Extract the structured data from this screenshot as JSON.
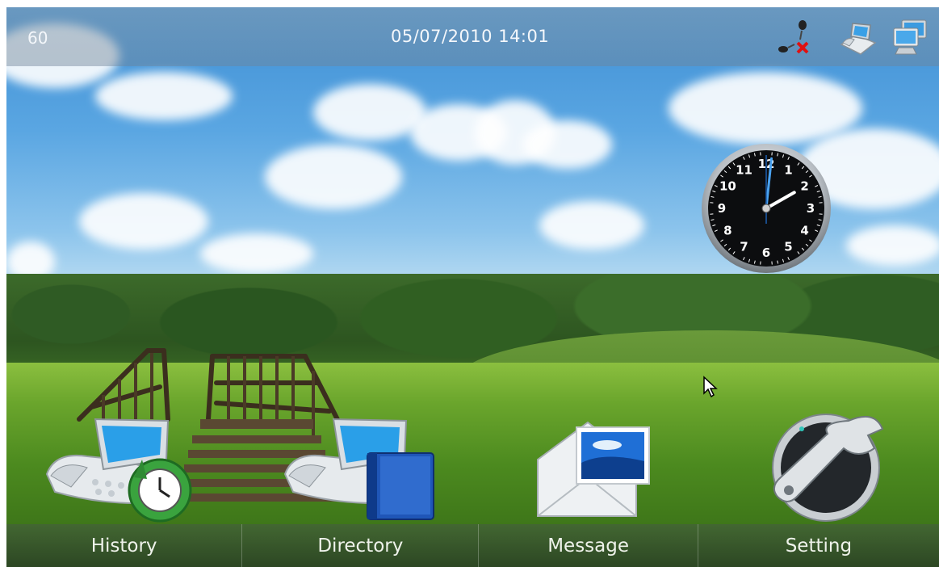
{
  "status_bar": {
    "volume": "60",
    "datetime": "05/07/2010 14:01",
    "icons": [
      "network-disconnected-icon",
      "ip-phone-icon",
      "computer-network-icon"
    ]
  },
  "clock": {
    "hour": 14,
    "minute": 1,
    "numerals": [
      "12",
      "1",
      "2",
      "3",
      "4",
      "5",
      "6",
      "7",
      "8",
      "9",
      "10",
      "11"
    ]
  },
  "apps": [
    {
      "label": "History",
      "icon": "phone-history-icon"
    },
    {
      "label": "Directory",
      "icon": "phone-directory-icon"
    },
    {
      "label": "Message",
      "icon": "message-envelope-icon"
    },
    {
      "label": "Setting",
      "icon": "wrench-settings-icon"
    }
  ],
  "colors": {
    "sky_top": "#3f8fd4",
    "grass": "#4c8a1f",
    "bar_text": "#eef2ea"
  }
}
